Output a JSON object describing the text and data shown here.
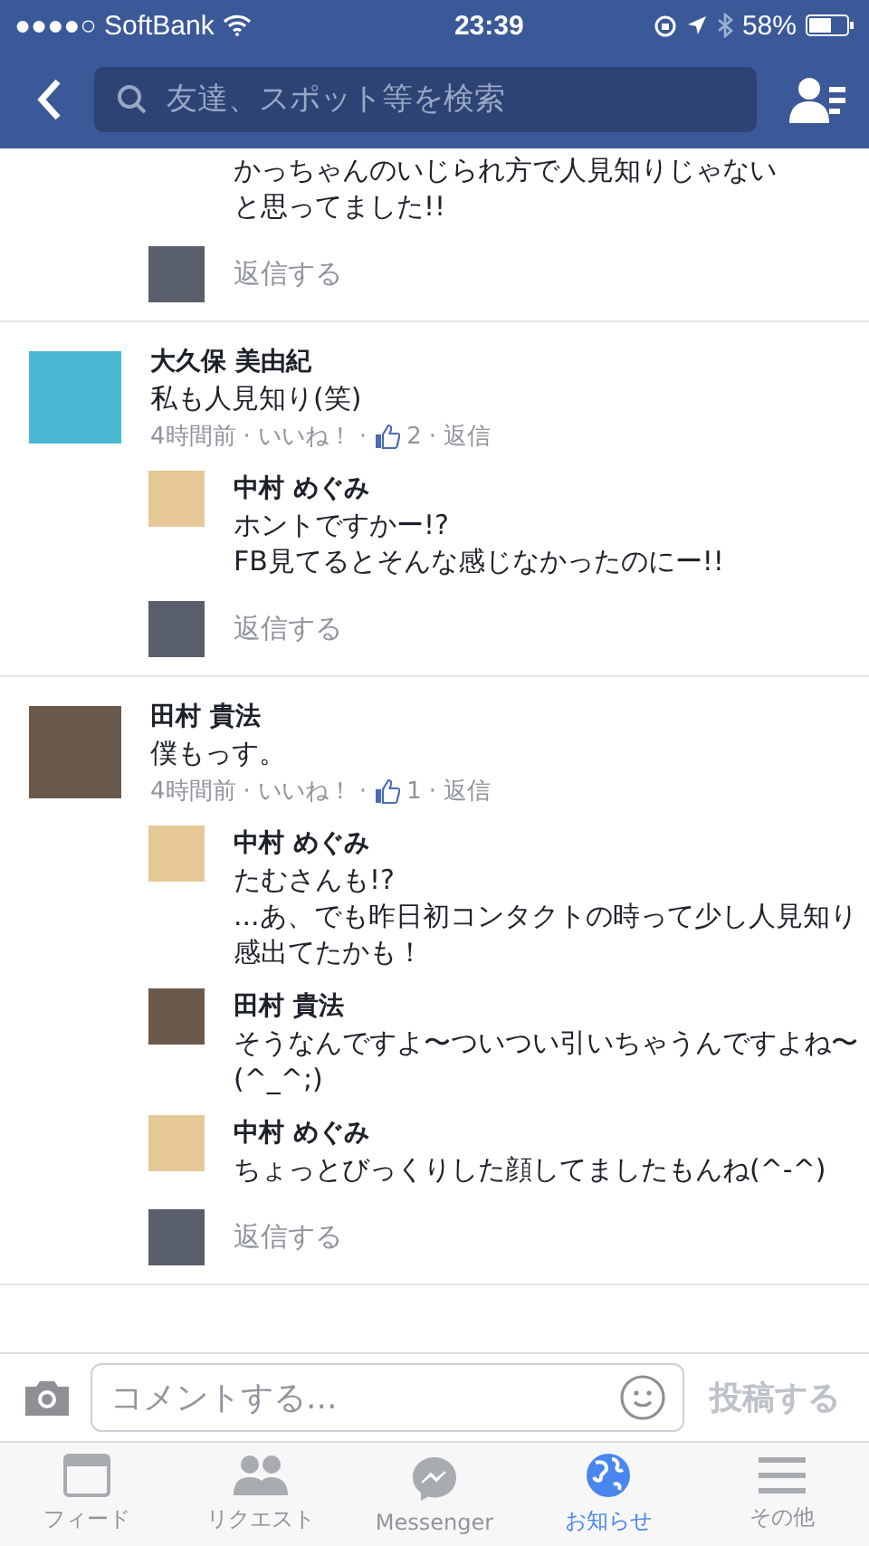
{
  "status_bar": {
    "carrier": "●●●●○ SoftBank",
    "time": "23:39",
    "battery": "58%"
  },
  "search": {
    "placeholder": "友達、スポット等を検索"
  },
  "top_fragment": {
    "lines": [
      "かっちゃんのいじられ方で人見知りじゃない",
      "と思ってました!!"
    ],
    "reply_prompt": "返信する"
  },
  "comments": [
    {
      "name": "大久保 美由紀",
      "text": "私も人見知り(笑)",
      "time": "4時間前",
      "like": "いいね！",
      "like_count": "2",
      "separator": "·",
      "reply": "返信",
      "replies": [
        {
          "name": "中村 めぐみ",
          "lines": [
            "ホントですかー!?",
            "FB見てるとそんな感じなかったのにー!!"
          ]
        }
      ],
      "reply_prompt": "返信する"
    },
    {
      "name": "田村 貴法",
      "text": "僕もっす。",
      "time": "4時間前",
      "like": "いいね！",
      "like_count": "1",
      "separator": "·",
      "reply": "返信",
      "replies": [
        {
          "name": "中村 めぐみ",
          "lines": [
            "たむさんも!?",
            "...あ、でも昨日初コンタクトの時って少し人見知り感出てたかも！"
          ]
        },
        {
          "name": "田村 貴法",
          "lines": [
            "そうなんですよ〜ついつい引いちゃうんですよね〜(^_^;)"
          ]
        },
        {
          "name": "中村 めぐみ",
          "lines": [
            "ちょっとびっくりした顔してましたもんね(^-^)"
          ]
        }
      ],
      "reply_prompt": "返信する"
    }
  ],
  "composer": {
    "placeholder": "コメントする...",
    "post": "投稿する"
  },
  "tabs": [
    {
      "label": "フィード",
      "kind": "feed",
      "selected": false
    },
    {
      "label": "リクエスト",
      "kind": "requests",
      "selected": false
    },
    {
      "label": "Messenger",
      "kind": "messenger",
      "selected": false
    },
    {
      "label": "お知らせ",
      "kind": "notifications",
      "selected": true
    },
    {
      "label": "その他",
      "kind": "more",
      "selected": false
    }
  ]
}
